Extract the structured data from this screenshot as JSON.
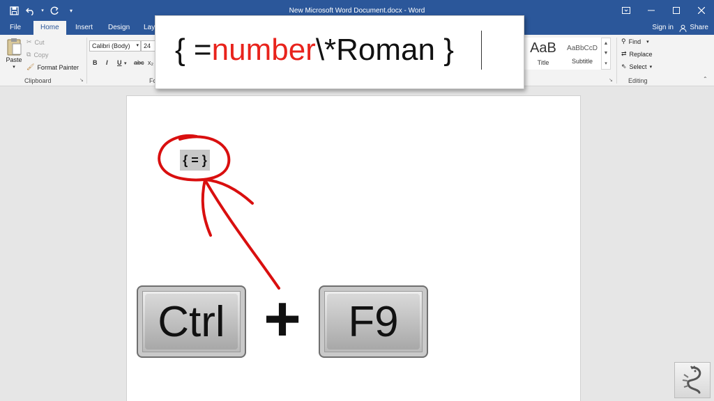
{
  "window": {
    "title": "New Microsoft Word Document.docx - Word",
    "qat": [
      "save-icon",
      "undo-icon",
      "redo-icon",
      "customize-icon"
    ],
    "controls": [
      "ribbon-display-icon",
      "minimize-icon",
      "maximize-icon",
      "close-icon"
    ]
  },
  "tabs": [
    "File",
    "Home",
    "Insert",
    "Design",
    "Lay"
  ],
  "active_tab": "Home",
  "account": {
    "signin": "Sign in",
    "share": "Share"
  },
  "ribbon": {
    "clipboard": {
      "paste": "Paste",
      "cut": "Cut",
      "copy": "Copy",
      "format_painter": "Format Painter",
      "label": "Clipboard"
    },
    "font": {
      "name": "Calibri (Body)",
      "size": "24",
      "bold": "B",
      "italic": "I",
      "underline": "U",
      "strike": "abc",
      "subscript": "x₂",
      "label": "Fo"
    },
    "styles": [
      {
        "preview": "AaB",
        "name": "Title"
      },
      {
        "preview": "AaBbCcD",
        "name": "Subtitle"
      }
    ],
    "editing": {
      "find": "Find",
      "replace": "Replace",
      "select": "Select",
      "label": "Editing"
    }
  },
  "popup": {
    "open_brace": "{ =",
    "highlight": "number",
    "rest": "\\*Roman }",
    "highlight_color": "#e8231c"
  },
  "document": {
    "field_code": "{ = }"
  },
  "keys": {
    "key1": "Ctrl",
    "plus": "+",
    "key2": "F9"
  },
  "colors": {
    "titlebar": "#2b579a",
    "annotation": "#d90f0f"
  }
}
